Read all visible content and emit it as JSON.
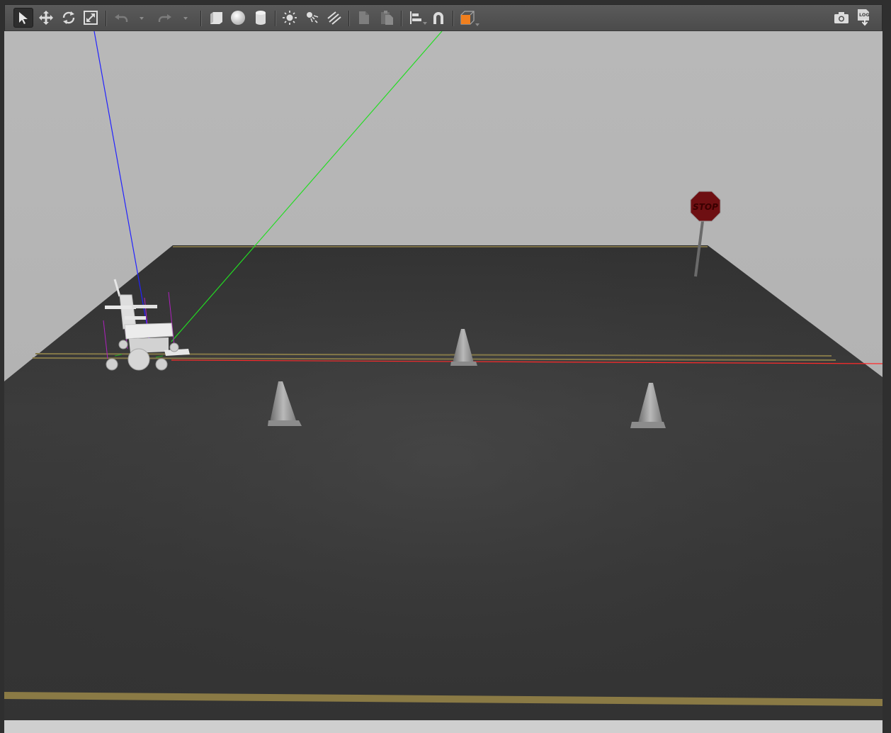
{
  "toolbar": {
    "left_tools": [
      {
        "name": "select-mode",
        "icon": "arrow-cursor-icon",
        "active": true
      },
      {
        "name": "translate-mode",
        "icon": "move-arrows-icon"
      },
      {
        "name": "rotate-mode",
        "icon": "rotate-icon"
      },
      {
        "name": "scale-mode",
        "icon": "scale-icon"
      },
      {
        "name": "undo",
        "icon": "undo-icon",
        "disabled": true
      },
      {
        "name": "redo",
        "icon": "redo-icon",
        "disabled": true
      },
      {
        "name": "insert-box",
        "icon": "box-shape-icon"
      },
      {
        "name": "insert-sphere",
        "icon": "sphere-shape-icon"
      },
      {
        "name": "insert-cylinder",
        "icon": "cylinder-shape-icon"
      },
      {
        "name": "point-light",
        "icon": "point-light-icon"
      },
      {
        "name": "spot-light",
        "icon": "spot-light-icon"
      },
      {
        "name": "directional-light",
        "icon": "directional-light-icon"
      },
      {
        "name": "copy",
        "icon": "copy-icon",
        "disabled": true
      },
      {
        "name": "paste",
        "icon": "paste-icon",
        "disabled": true
      },
      {
        "name": "align",
        "icon": "align-icon"
      },
      {
        "name": "snap",
        "icon": "magnet-icon"
      },
      {
        "name": "view-angle",
        "icon": "view-cube-icon"
      }
    ],
    "right_tools": [
      {
        "name": "screenshot",
        "icon": "camera-icon"
      },
      {
        "name": "log",
        "icon": "log-icon",
        "label": "LOG"
      }
    ],
    "accent_color": "#f07f1e"
  },
  "scene": {
    "sky_color": "#b4b4b4",
    "ground_color": "#3c3c3c",
    "line_color": "#8a7a45",
    "axis_colors": {
      "x": "#ff2a2a",
      "y": "#22dd22",
      "z": "#2222ff"
    },
    "stop_sign": {
      "text": "STOP",
      "color": "#6e0f12"
    },
    "objects": [
      "wheelchair-model",
      "traffic-cone",
      "traffic-cone",
      "traffic-cone",
      "stop-sign"
    ]
  }
}
